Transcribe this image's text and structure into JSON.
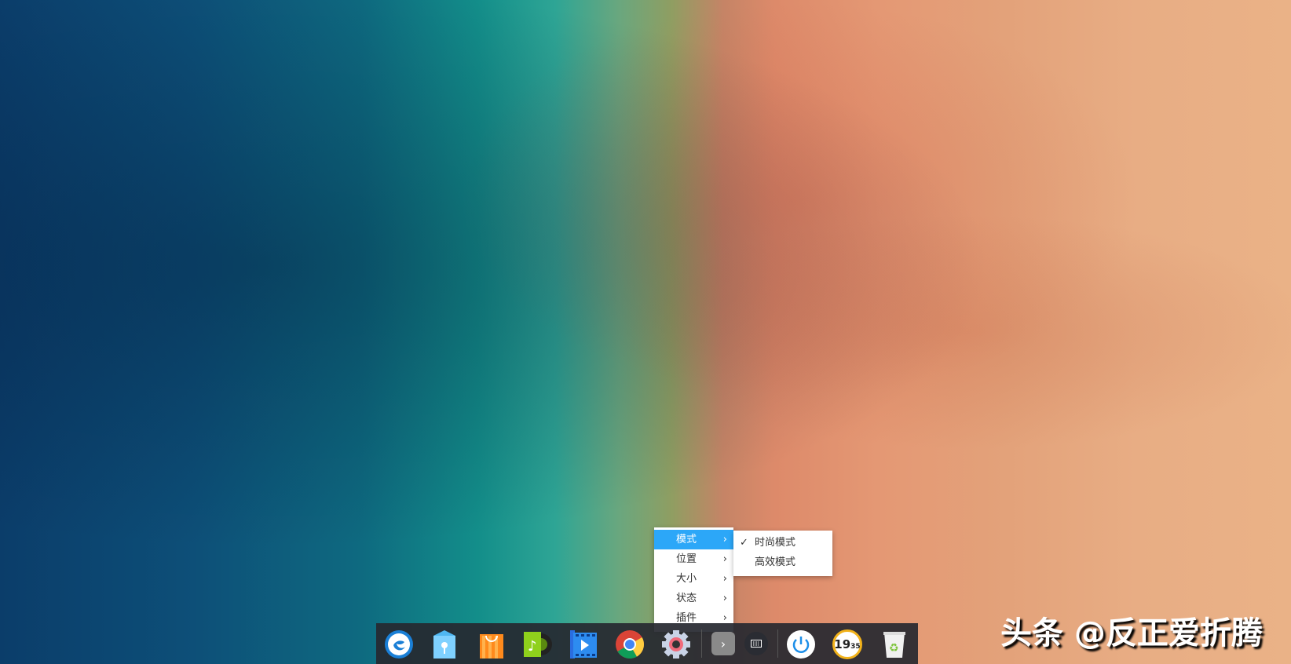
{
  "context_menu": {
    "items": [
      {
        "label": "模式",
        "active": true
      },
      {
        "label": "位置"
      },
      {
        "label": "大小"
      },
      {
        "label": "状态"
      },
      {
        "label": "插件"
      }
    ],
    "arrow": "›"
  },
  "submenu": {
    "items": [
      {
        "label": "时尚模式",
        "checked": true,
        "check": "✓"
      },
      {
        "label": "高效模式",
        "checked": false
      }
    ]
  },
  "dock": {
    "apps": [
      "launcher",
      "file-manager",
      "app-store",
      "music",
      "video-player",
      "chrome",
      "settings"
    ],
    "tray": {
      "expand": "›",
      "clock_hour": "19",
      "clock_min": "35"
    }
  },
  "watermark": "头条 @反正爱折腾"
}
